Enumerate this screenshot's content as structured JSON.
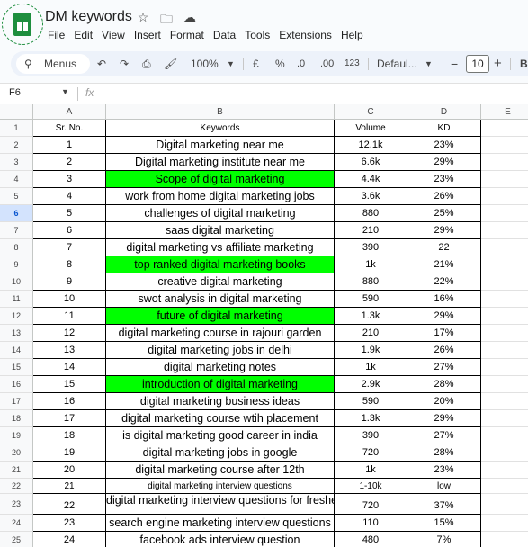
{
  "doc": {
    "title": "DM keywords"
  },
  "menu": [
    "File",
    "Edit",
    "View",
    "Insert",
    "Format",
    "Data",
    "Tools",
    "Extensions",
    "Help"
  ],
  "toolbar": {
    "search_label": "Menus",
    "zoom": "100%",
    "currency": "£",
    "percent": "%",
    "dec_decrease": ".0",
    "dec_increase": ".00",
    "number_format": "123",
    "font": "Defaul...",
    "font_size": "10",
    "minus": "−",
    "plus": "+"
  },
  "formula_bar": {
    "cell_ref": "F6",
    "fx": "fx"
  },
  "columns": [
    "A",
    "B",
    "C",
    "D",
    "E"
  ],
  "selected_row": 6,
  "rows": [
    {
      "n": "1",
      "a": "Sr. No.",
      "b": "Keywords",
      "c": "Volume",
      "d": "KD",
      "h": 19,
      "header": true
    },
    {
      "n": "2",
      "a": "1",
      "b": "Digital marketing near me",
      "c": "12.1k",
      "d": "23%",
      "h": 19
    },
    {
      "n": "3",
      "a": "2",
      "b": "Digital marketing institute near me",
      "c": "6.6k",
      "d": "29%",
      "h": 19
    },
    {
      "n": "4",
      "a": "3",
      "b": "Scope of digital marketing",
      "c": "4.4k",
      "d": "23%",
      "h": 19,
      "green": true
    },
    {
      "n": "5",
      "a": "4",
      "b": "work from home digital marketing jobs",
      "c": "3.6k",
      "d": "26%",
      "h": 19
    },
    {
      "n": "6",
      "a": "5",
      "b": "challenges of digital marketing",
      "c": "880",
      "d": "25%",
      "h": 19
    },
    {
      "n": "7",
      "a": "6",
      "b": "saas digital marketing",
      "c": "210",
      "d": "29%",
      "h": 19
    },
    {
      "n": "8",
      "a": "7",
      "b": "digital marketing vs affiliate marketing",
      "c": "390",
      "d": "22",
      "h": 19
    },
    {
      "n": "9",
      "a": "8",
      "b": "top ranked digital marketing books",
      "c": "1k",
      "d": "21%",
      "h": 19,
      "green": true
    },
    {
      "n": "10",
      "a": "9",
      "b": "creative digital marketing",
      "c": "880",
      "d": "22%",
      "h": 19
    },
    {
      "n": "11",
      "a": "10",
      "b": "swot analysis in digital marketing",
      "c": "590",
      "d": "16%",
      "h": 19
    },
    {
      "n": "12",
      "a": "11",
      "b": "future of digital marketing",
      "c": "1.3k",
      "d": "29%",
      "h": 19,
      "green": true
    },
    {
      "n": "13",
      "a": "12",
      "b": "digital marketing course in rajouri garden",
      "c": "210",
      "d": "17%",
      "h": 19
    },
    {
      "n": "14",
      "a": "13",
      "b": "digital marketing jobs in delhi",
      "c": "1.9k",
      "d": "26%",
      "h": 19
    },
    {
      "n": "15",
      "a": "14",
      "b": "digital marketing notes",
      "c": "1k",
      "d": "27%",
      "h": 19
    },
    {
      "n": "16",
      "a": "15",
      "b": "introduction of digital marketing",
      "c": "2.9k",
      "d": "28%",
      "h": 19,
      "green": true
    },
    {
      "n": "17",
      "a": "16",
      "b": "digital marketing business ideas",
      "c": "590",
      "d": "20%",
      "h": 19
    },
    {
      "n": "18",
      "a": "17",
      "b": "digital marketing course wtih placement",
      "c": "1.3k",
      "d": "29%",
      "h": 19
    },
    {
      "n": "19",
      "a": "18",
      "b": "is digital marketing good career in india",
      "c": "390",
      "d": "27%",
      "h": 19
    },
    {
      "n": "20",
      "a": "19",
      "b": "digital marketing jobs in google",
      "c": "720",
      "d": "28%",
      "h": 19
    },
    {
      "n": "21",
      "a": "20",
      "b": "digital marketing course after 12th",
      "c": "1k",
      "d": "23%",
      "h": 19
    },
    {
      "n": "22",
      "a": "21",
      "b": "digital marketing interview questions",
      "c": "1-10k",
      "d": "low",
      "h": 17,
      "small": true
    },
    {
      "n": "23",
      "a": "22",
      "b": "digital marketing interview questions for fresher",
      "c": "720",
      "d": "37%",
      "h": 23,
      "top": true
    },
    {
      "n": "24",
      "a": "23",
      "b": "search engine marketing interview questions",
      "c": "110",
      "d": "15%",
      "h": 19
    },
    {
      "n": "25",
      "a": "24",
      "b": "facebook ads interview question",
      "c": "480",
      "d": "7%",
      "h": 19
    }
  ],
  "colors": {
    "green_fill": "#00ff00",
    "selected_row_header": "#d3e3fd"
  }
}
